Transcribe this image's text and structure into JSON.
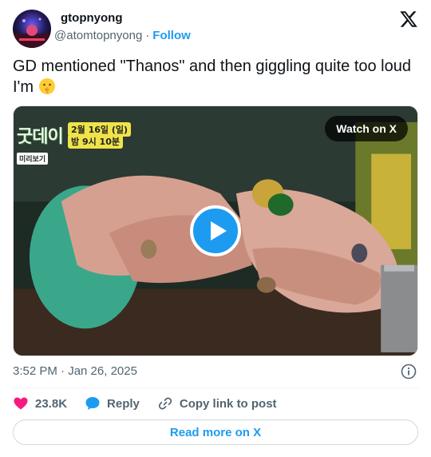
{
  "tweet": {
    "display_name": "gtopnyong",
    "handle": "@atomtopnyong",
    "separator": "·",
    "follow_label": "Follow",
    "text": "GD mentioned \"Thanos\" and then giggling quite too loud I'm",
    "text_emoji": "shushing-face-emoji",
    "timestamp": "3:52 PM · Jan 26, 2025"
  },
  "media": {
    "watch_label": "Watch on X",
    "overlay_logo": "굿데이",
    "overlay_date": "2월 16일 (일)",
    "overlay_time": "밤 9시 10분",
    "overlay_preview": "미리보기",
    "play_icon": "play-icon"
  },
  "actions": {
    "like_count": "23.8K",
    "reply_label": "Reply",
    "copy_label": "Copy link to post"
  },
  "footer": {
    "read_more_label": "Read more on X"
  },
  "colors": {
    "accent": "#1d9bf0",
    "like": "#f91880",
    "text": "#0f1419",
    "muted": "#536471"
  }
}
